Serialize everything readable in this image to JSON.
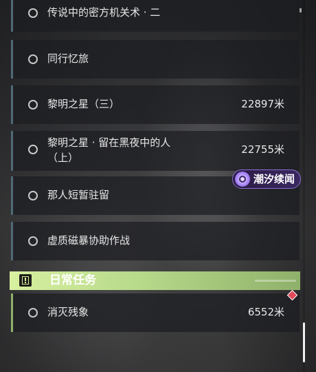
{
  "quests": [
    {
      "name": "传说中的密方机关术 · 二",
      "distance": ""
    },
    {
      "name": "同行忆旅",
      "distance": ""
    },
    {
      "name": "黎明之星（三）",
      "distance": "22897米"
    },
    {
      "name": "黎明之星 · 留在黑夜中的人（上）",
      "distance": "22755米"
    },
    {
      "name": "那人短暂驻留",
      "distance": ""
    },
    {
      "name": "虚质磁暴协助作战",
      "distance": ""
    }
  ],
  "daily_section": {
    "title": "日常任务",
    "quests": [
      {
        "name": "消灭残象",
        "distance": "6552米"
      }
    ]
  },
  "badge": {
    "label": "潮汐续闻",
    "icon": "tide-event-icon"
  },
  "icons": {
    "quest_status": "circle-outline-icon",
    "section": "exclamation-icon",
    "tracked": "diamond-marker-icon"
  },
  "colors": {
    "main_accent": "#4f6a78",
    "daily_accent": "#8fb06a",
    "daily_header": "#b6d98a",
    "badge_purple": "#8a6fd0",
    "marker_red": "#e04a5a"
  }
}
